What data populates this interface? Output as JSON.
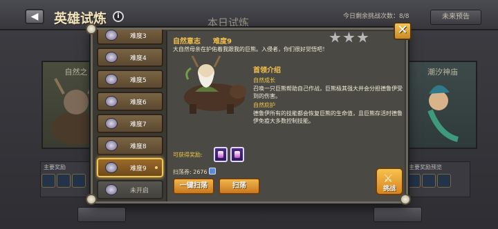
{
  "header": {
    "page_title": "英雄试炼",
    "info_glyph": "i",
    "today_title": "本日试炼",
    "remaining_text": "今日剩余挑战次数：8/8",
    "preview_label": "未来预告"
  },
  "background": {
    "left_card_name": "自然之",
    "right_card_name": "潮汐神庙",
    "left_rewards_label": "主要奖励",
    "right_rewards_label": "主要奖励预览",
    "bottom_left_btn": "",
    "bottom_right_btn": ""
  },
  "difficulties": [
    {
      "label": "难度3",
      "state": "normal",
      "icon": "difficulty-3-icon"
    },
    {
      "label": "难度4",
      "state": "normal",
      "icon": "difficulty-4-icon"
    },
    {
      "label": "难度5",
      "state": "normal",
      "icon": "difficulty-5-icon"
    },
    {
      "label": "难度6",
      "state": "normal",
      "icon": "difficulty-6-icon"
    },
    {
      "label": "难度7",
      "state": "normal",
      "icon": "difficulty-7-icon"
    },
    {
      "label": "难度8",
      "state": "normal",
      "icon": "difficulty-8-icon"
    },
    {
      "label": "难度9",
      "state": "active",
      "icon": "difficulty-9-icon"
    },
    {
      "label": "未开启",
      "state": "locked",
      "icon": "difficulty-locked-icon"
    }
  ],
  "detail": {
    "boss_name": "自然意志",
    "difficulty_tag": "难度9",
    "stars_filled": 0,
    "stars_total": 3,
    "quote": "大自然母亲在护佑着我跟我的巨熊。入侵者，你们很好觉悟吧！",
    "intro_title": "首领介绍",
    "skills": [
      {
        "name": "自然成长",
        "desc": "召唤一只巨熊帮助自己作战，巨熊极其强大并会分担德鲁伊受到的伤害。"
      },
      {
        "name": "自然庇护",
        "desc": "德鲁伊所有的技能都会恢复巨熊的生命值，且巨熊存活时德鲁伊免疫大多数控制技能。"
      }
    ],
    "reward_label": "可获得奖励:",
    "sweep_label": "扫荡券:",
    "sweep_count": "2676",
    "btn_sweep_all": "一键扫荡",
    "btn_sweep": "扫荡",
    "btn_challenge": "挑战"
  },
  "close_glyph": "✕",
  "colors": {
    "accent_gold": "#f5c14c",
    "active_border": "#f3c451",
    "button_orange": "#e3a03a"
  }
}
